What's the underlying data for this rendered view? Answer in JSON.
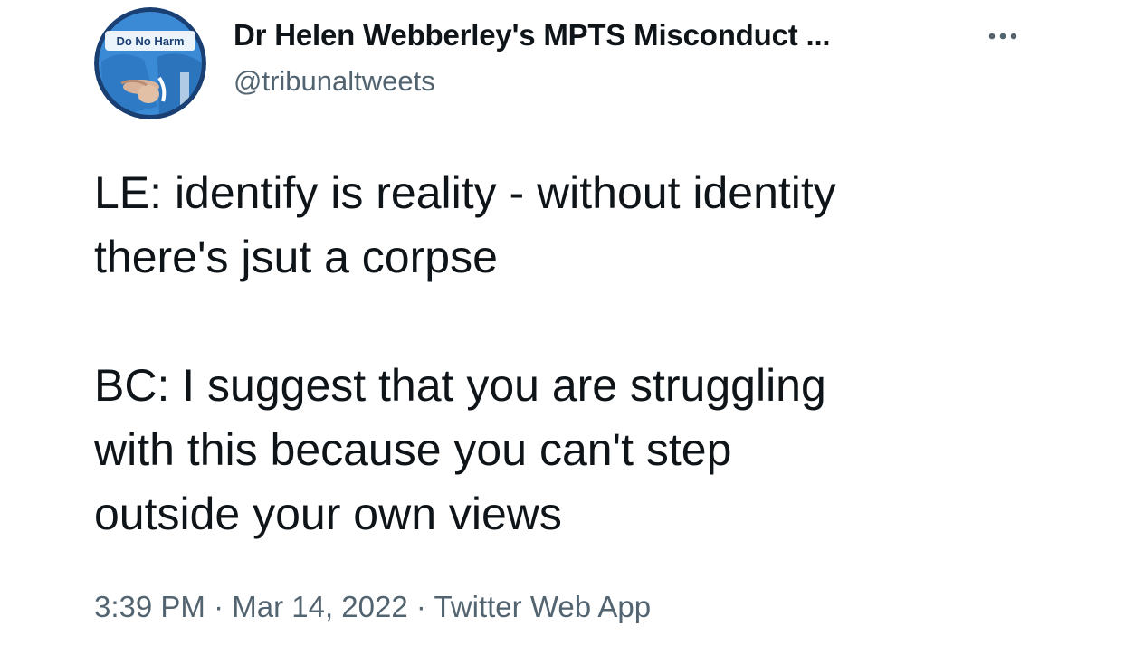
{
  "avatar": {
    "badge_text": "Do No Harm",
    "accent": "#1f78c8"
  },
  "author": {
    "display_name": "Dr Helen Webberley's MPTS Misconduct ...",
    "handle": "@tribunaltweets"
  },
  "more_icon": "more-horizontal-icon",
  "tweet": {
    "paragraphs": [
      {
        "lines": [
          "LE: identify is reality - without identity",
          "there's jsut a corpse"
        ]
      },
      {
        "lines": [
          "BC: I suggest that you are struggling",
          "with this because you can't step",
          "outside your own views"
        ]
      }
    ]
  },
  "meta": {
    "time": "3:39 PM",
    "separator": "·",
    "date": "Mar 14, 2022",
    "source": "Twitter Web App"
  },
  "colors": {
    "text_primary": "#0f1419",
    "text_secondary": "#536471",
    "background": "#ffffff"
  }
}
